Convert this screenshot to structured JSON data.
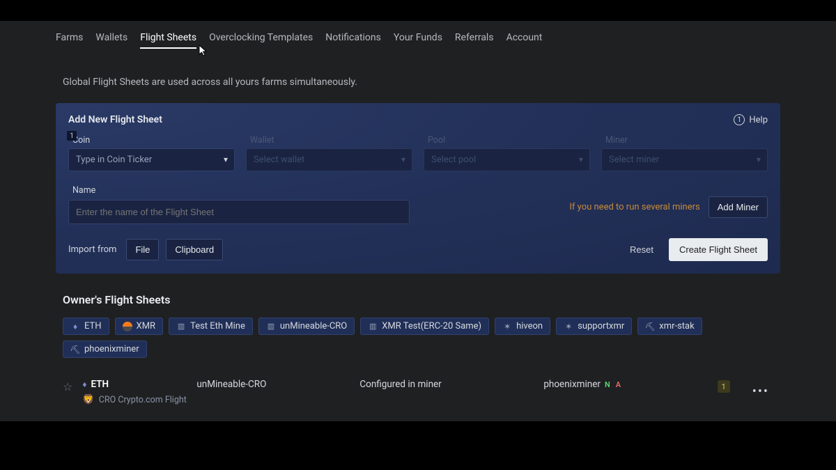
{
  "nav": {
    "items": [
      "Farms",
      "Wallets",
      "Flight Sheets",
      "Overclocking Templates",
      "Notifications",
      "Your Funds",
      "Referrals",
      "Account"
    ],
    "active_index": 2
  },
  "info_note": "Global Flight Sheets are used across all yours farms simultaneously.",
  "panel": {
    "title": "Add New Flight Sheet",
    "help_label": "Help",
    "step_badge": "1",
    "fields": {
      "coin": {
        "label": "Coin",
        "placeholder": "Type in Coin Ticker"
      },
      "wallet": {
        "label": "Wallet",
        "placeholder": "Select wallet"
      },
      "pool": {
        "label": "Pool",
        "placeholder": "Select pool"
      },
      "miner": {
        "label": "Miner",
        "placeholder": "Select miner"
      }
    },
    "name_field": {
      "label": "Name",
      "placeholder": "Enter the name of the Flight Sheet"
    },
    "miner_note": "If you need to run several miners",
    "add_miner": "Add Miner",
    "import_label": "Import from",
    "import_file": "File",
    "import_clipboard": "Clipboard",
    "reset": "Reset",
    "create": "Create Flight Sheet"
  },
  "owner": {
    "title": "Owner's Flight Sheets",
    "chips": [
      {
        "icon": "eth",
        "label": "ETH"
      },
      {
        "icon": "xmr",
        "label": "XMR"
      },
      {
        "icon": "cog",
        "label": "Test Eth Mine"
      },
      {
        "icon": "cog",
        "label": "unMineable-CRO"
      },
      {
        "icon": "cog",
        "label": "XMR Test(ERC-20 Same)"
      },
      {
        "icon": "ant",
        "label": "hiveon"
      },
      {
        "icon": "ant",
        "label": "supportxmr"
      },
      {
        "icon": "pick",
        "label": "xmr-stak"
      },
      {
        "icon": "pick",
        "label": "phoenixminer"
      }
    ],
    "row": {
      "coin": "ETH",
      "sub": "CRO Crypto.com Flight",
      "wallet": "unMineable-CRO",
      "pool": "Configured in miner",
      "miner": "phoenixminer",
      "tag_n": "N",
      "tag_a": "A",
      "count": "1"
    }
  }
}
